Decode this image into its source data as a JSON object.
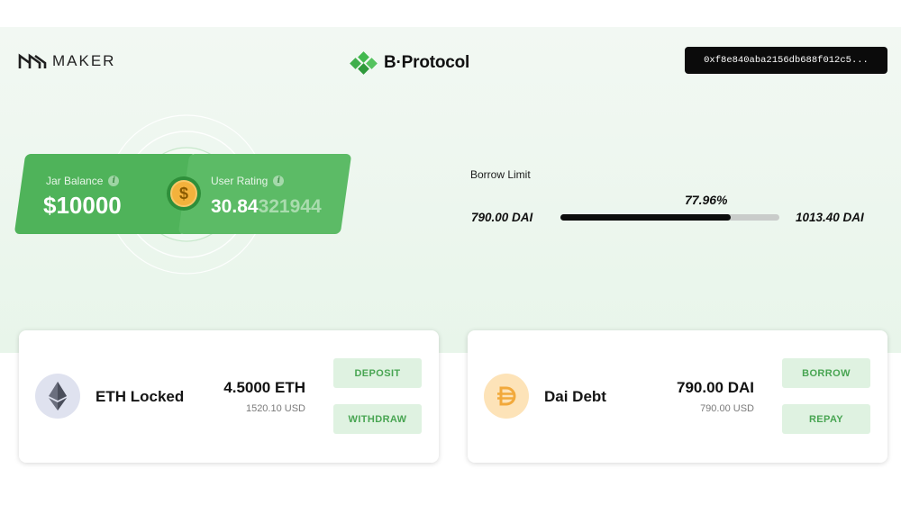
{
  "header": {
    "maker_label": "MAKER",
    "brand_label": "B·Protocol",
    "wallet_address": "0xf8e840aba2156db688f012c5..."
  },
  "jar": {
    "label": "Jar Balance",
    "value": "$10000"
  },
  "rating": {
    "label": "User Rating",
    "value_main": "30.84",
    "value_rest": "321944"
  },
  "borrow": {
    "title": "Borrow Limit",
    "percent_label": "77.96%",
    "percent": 0.7796,
    "min": "790.00 DAI",
    "max": "1013.40 DAI"
  },
  "eth": {
    "name": "ETH Locked",
    "amount": "4.5000 ETH",
    "usd": "1520.10 USD",
    "btn_primary": "DEPOSIT",
    "btn_secondary": "WITHDRAW"
  },
  "dai": {
    "name": "Dai Debt",
    "amount": "790.00 DAI",
    "usd": "790.00 USD",
    "btn_primary": "BORROW",
    "btn_secondary": "REPAY"
  },
  "colors": {
    "accent_green": "#4fb35a",
    "button_bg": "#dff2e1",
    "button_text": "#48a552",
    "hero_bg": "#eef7f0"
  }
}
